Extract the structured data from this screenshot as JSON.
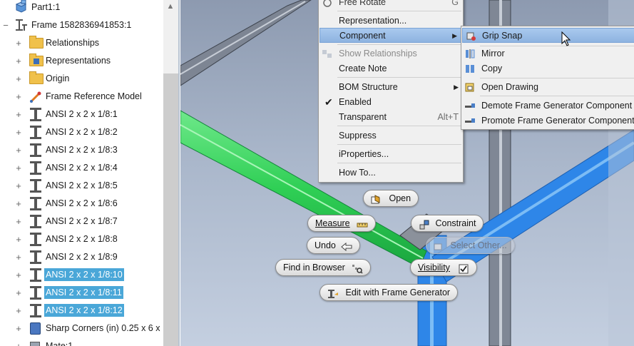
{
  "browser": {
    "root_label": "Part1:1",
    "frame_label": "Frame 1582836941853:1",
    "children": [
      {
        "label": "Relationships",
        "icon": "folder-icon"
      },
      {
        "label": "Representations",
        "icon": "representations-folder-icon"
      },
      {
        "label": "Origin",
        "icon": "folder-icon"
      },
      {
        "label": "Frame Reference Model",
        "icon": "frame-reference-model-icon"
      },
      {
        "label": "ANSI 2 x 2 x 1/8:1",
        "icon": "ibeam-icon"
      },
      {
        "label": "ANSI 2 x 2 x 1/8:2",
        "icon": "ibeam-icon"
      },
      {
        "label": "ANSI 2 x 2 x 1/8:3",
        "icon": "ibeam-icon"
      },
      {
        "label": "ANSI 2 x 2 x 1/8:4",
        "icon": "ibeam-icon"
      },
      {
        "label": "ANSI 2 x 2 x 1/8:5",
        "icon": "ibeam-icon"
      },
      {
        "label": "ANSI 2 x 2 x 1/8:6",
        "icon": "ibeam-icon"
      },
      {
        "label": "ANSI 2 x 2 x 1/8:7",
        "icon": "ibeam-icon"
      },
      {
        "label": "ANSI 2 x 2 x 1/8:8",
        "icon": "ibeam-icon"
      },
      {
        "label": "ANSI 2 x 2 x 1/8:9",
        "icon": "ibeam-icon"
      },
      {
        "label": "ANSI 2 x 2 x 1/8:10",
        "icon": "ibeam-icon",
        "selected": true
      },
      {
        "label": "ANSI 2 x 2 x 1/8:11",
        "icon": "ibeam-icon",
        "selected": true
      },
      {
        "label": "ANSI 2 x 2 x 1/8:12",
        "icon": "ibeam-icon",
        "selected": true
      },
      {
        "label": "Sharp Corners (in) 0.25 x 6 x",
        "icon": "plate-icon"
      },
      {
        "label": "Mate:1",
        "icon": "mate-icon"
      }
    ]
  },
  "context_menu": {
    "free_rotate": {
      "label": "Free Rotate",
      "shortcut": "G"
    },
    "representation": "Representation...",
    "component": "Component",
    "show_relationships": "Show Relationships",
    "create_note": "Create Note",
    "bom_structure": "BOM Structure",
    "enabled": "Enabled",
    "transparent": {
      "label": "Transparent",
      "shortcut": "Alt+T"
    },
    "suppress": "Suppress",
    "iproperties": "iProperties...",
    "how_to": "How To..."
  },
  "submenu": {
    "grip_snap": "Grip Snap",
    "mirror": "Mirror",
    "copy": "Copy",
    "open_drawing": "Open Drawing",
    "demote": "Demote Frame Generator Component",
    "promote": "Promote Frame Generator Component"
  },
  "marking_menu": {
    "open": "Open",
    "measure": "Measure",
    "constraint": "Constraint",
    "select_other": "Select Other...",
    "undo": "Undo",
    "find_in_browser": "Find in Browser",
    "visibility": "Visibility",
    "edit_frame_generator": "Edit with Frame Generator"
  },
  "colors": {
    "selection": "#4aa7d8",
    "menu_highlight": "#a9c9ee",
    "green_member": "#31d25a",
    "blue_member": "#2e86e8"
  }
}
